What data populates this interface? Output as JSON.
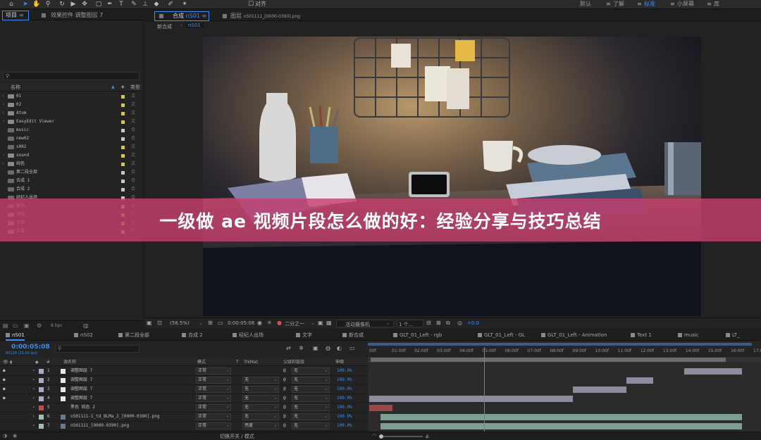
{
  "toolbar": {
    "options_label": "对齐",
    "workspaces": [
      "默认",
      "了解",
      "标准",
      "小屏幕",
      "库"
    ],
    "active_workspace_index": 2
  },
  "project": {
    "tab_label": "项目",
    "effects_tab_label": "效果控件 调整图层 7",
    "col_name": "名称",
    "col_type": "类型",
    "search_placeholder": "",
    "items": [
      {
        "name": "01",
        "kind": "folder",
        "label_color": "#d8c84a",
        "type": "文"
      },
      {
        "name": "02",
        "kind": "folder",
        "label_color": "#d8c84a",
        "type": "文"
      },
      {
        "name": "Atom",
        "kind": "folder",
        "label_color": "#d8c84a",
        "type": "文"
      },
      {
        "name": "EasyEdit Viewer",
        "kind": "folder",
        "label_color": "#d8c84a",
        "type": "文"
      },
      {
        "name": "music",
        "kind": "comp",
        "label_color": "#c8c8c8",
        "type": "合"
      },
      {
        "name": "new02",
        "kind": "comp",
        "label_color": "#c8c8c8",
        "type": "合"
      },
      {
        "name": "s002",
        "kind": "comp",
        "label_color": "#d8c84a",
        "type": "文"
      },
      {
        "name": "sound",
        "kind": "folder",
        "label_color": "#d8c84a",
        "type": "文"
      },
      {
        "name": "纯色",
        "kind": "folder",
        "label_color": "#d8c84a",
        "type": "文"
      },
      {
        "name": "第二段全部",
        "kind": "comp",
        "label_color": "#c8c8c8",
        "type": "合"
      },
      {
        "name": "合成 1",
        "kind": "comp",
        "label_color": "#c8c8c8",
        "type": "合"
      },
      {
        "name": "合成 2",
        "kind": "comp",
        "label_color": "#c8c8c8",
        "type": "合"
      },
      {
        "name": "经纪人出场",
        "kind": "comp",
        "label_color": "#c8c8c8",
        "type": "合"
      },
      {
        "name": "建筑",
        "kind": "comp",
        "label_color": "#c8c8c8",
        "type": "合"
      },
      {
        "name": "视频",
        "kind": "folder",
        "label_color": "#d8c84a",
        "type": "文"
      },
      {
        "name": "文字",
        "kind": "folder",
        "label_color": "#d8c84a",
        "type": "文"
      },
      {
        "name": "字幕",
        "kind": "folder",
        "label_color": "#d8c84a",
        "type": "文"
      }
    ],
    "footer_bpc": "8 bpc"
  },
  "viewer": {
    "comp_tab_label": "合成",
    "comp_tab_name": "nS01",
    "layer_tab_label": "图层",
    "layer_tab_name": "nS01111_[0000-0390].png",
    "breadcrumb_parent": "新合成",
    "breadcrumb_current": "nS01",
    "zoom": "(58.5%)",
    "timecode": "0:00:05:08",
    "resolution": "二分之一",
    "camera": "活动摄像机",
    "views": "1 个...",
    "exposure": "+0.0"
  },
  "banner": {
    "title": "一级做 ae 视频片段怎么做的好：经验分享与技巧总结"
  },
  "timeline": {
    "tabs": [
      "nS01",
      "nS02",
      "第二段全部",
      "合成 2",
      "经纪人出场",
      "文字",
      "新合成",
      "GLT_01_Left - rgb",
      "GLT_01_Left - GL",
      "GLT_01_Left - Animation",
      "Text 1",
      "music",
      "LT_"
    ],
    "active_tab_index": 0,
    "current_time": "0:00:05:08",
    "fps_label": "00128 (25.00 fps)",
    "col_source": "源名称",
    "col_mode": "模式",
    "col_t": "T",
    "col_trkmat": "TrkMat",
    "col_parent": "父级和链接",
    "col_stretch": "伸缩",
    "ruler_ticks": [
      "00f",
      "01:00f",
      "02:00f",
      "03:00f",
      "04:00f",
      "05:00f",
      "06:00f",
      "07:00f",
      "08:00f",
      "09:00f",
      "10:00f",
      "11:00f",
      "12:00f",
      "13:00f",
      "14:00f",
      "15:00f",
      "16:00f",
      "17:0"
    ],
    "playhead_frac": 0.295,
    "footer_label": "切换开关 / 模式",
    "layers": [
      {
        "num": "1",
        "name": "调整图层 7",
        "color": "#a9a9c8",
        "mode": "正常",
        "trkmat": "",
        "parent": "无",
        "stretch": "100.0%",
        "bar_start": 0.82,
        "bar_end": 0.97,
        "bar_color": "#8e8c9c",
        "visible": true
      },
      {
        "num": "2",
        "name": "调整图层 7",
        "color": "#a9a9c8",
        "mode": "正常",
        "trkmat": "无",
        "parent": "无",
        "stretch": "100.0%",
        "bar_start": 0.67,
        "bar_end": 0.74,
        "bar_color": "#8e8c9c",
        "visible": true
      },
      {
        "num": "3",
        "name": "调整图层 7",
        "color": "#a9a9c8",
        "mode": "正常",
        "trkmat": "无",
        "parent": "无",
        "stretch": "100.0%",
        "bar_start": 0.53,
        "bar_end": 0.67,
        "bar_color": "#8e8c9c",
        "visible": true
      },
      {
        "num": "4",
        "name": "调整图层 7",
        "color": "#a9a9c8",
        "mode": "正常",
        "trkmat": "无",
        "parent": "无",
        "stretch": "100.0%",
        "bar_start": 0.0,
        "bar_end": 0.53,
        "bar_color": "#8e8c9c",
        "visible": true
      },
      {
        "num": "5",
        "name": "黑色 纯色 2",
        "color": "#c84a4a",
        "mode": "正常",
        "trkmat": "无",
        "parent": "无",
        "stretch": "100.0%",
        "bar_start": 0.0,
        "bar_end": 0.06,
        "bar_color": "#9a4848",
        "visible": false
      },
      {
        "num": "6",
        "name": "nS01111-1_td_BLMa_2_[0000-0390].png",
        "color": "#9ec0b0",
        "mode": "正常",
        "trkmat": "无",
        "parent": "无",
        "stretch": "100.0%",
        "bar_start": 0.03,
        "bar_end": 0.97,
        "bar_color": "#7e9e94",
        "visible": false
      },
      {
        "num": "7",
        "name": "nS01111_[0000-0390].png",
        "color": "#9ec0b0",
        "mode": "正常",
        "trkmat": "亮度",
        "parent": "无",
        "stretch": "100.0%",
        "bar_start": 0.03,
        "bar_end": 0.97,
        "bar_color": "#7e9e94",
        "visible": false
      }
    ]
  }
}
